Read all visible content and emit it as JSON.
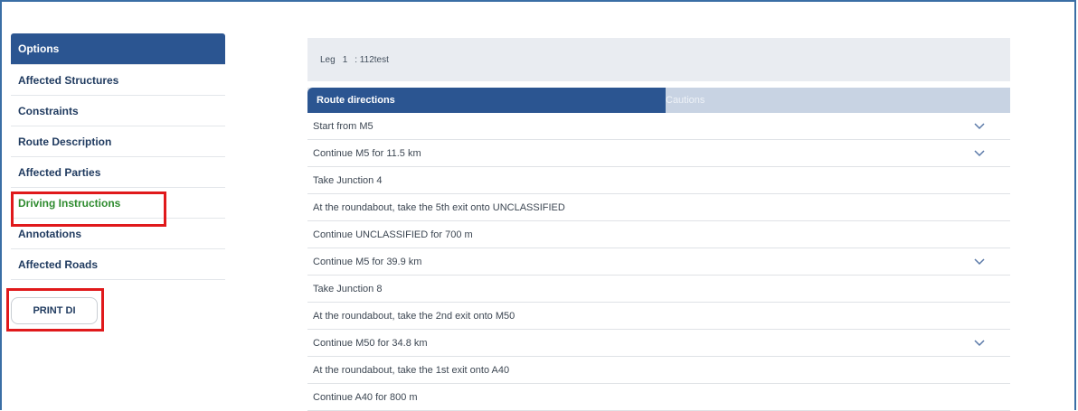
{
  "sidebar": {
    "items": [
      {
        "label": "Options"
      },
      {
        "label": "Affected Structures"
      },
      {
        "label": "Constraints"
      },
      {
        "label": "Route Description"
      },
      {
        "label": "Affected Parties"
      },
      {
        "label": "Driving Instructions"
      },
      {
        "label": "Annotations"
      },
      {
        "label": "Affected Roads"
      }
    ],
    "print_button": "PRINT DI"
  },
  "leg": {
    "label": "Leg",
    "number": "1",
    "name": ": 112test"
  },
  "tabs": {
    "active": "Route directions",
    "inactive": "Cautions"
  },
  "directions": [
    {
      "text": "Start from M5",
      "expandable": true
    },
    {
      "text": "Continue M5 for 11.5 km",
      "expandable": true
    },
    {
      "text": "Take Junction 4",
      "expandable": false
    },
    {
      "text": "At the roundabout, take the 5th exit onto UNCLASSIFIED",
      "expandable": false
    },
    {
      "text": "Continue UNCLASSIFIED for 700 m",
      "expandable": false
    },
    {
      "text": "Continue M5 for 39.9 km",
      "expandable": true
    },
    {
      "text": "Take Junction 8",
      "expandable": false
    },
    {
      "text": "At the roundabout, take the 2nd exit onto M50",
      "expandable": false
    },
    {
      "text": "Continue M50 for 34.8 km",
      "expandable": true
    },
    {
      "text": "At the roundabout, take the 1st exit onto A40",
      "expandable": false
    },
    {
      "text": "Continue A40 for 800 m",
      "expandable": false
    }
  ],
  "colors": {
    "primary": "#2b5591",
    "highlight": "#e0191b",
    "green_text": "#2e8b2e"
  }
}
